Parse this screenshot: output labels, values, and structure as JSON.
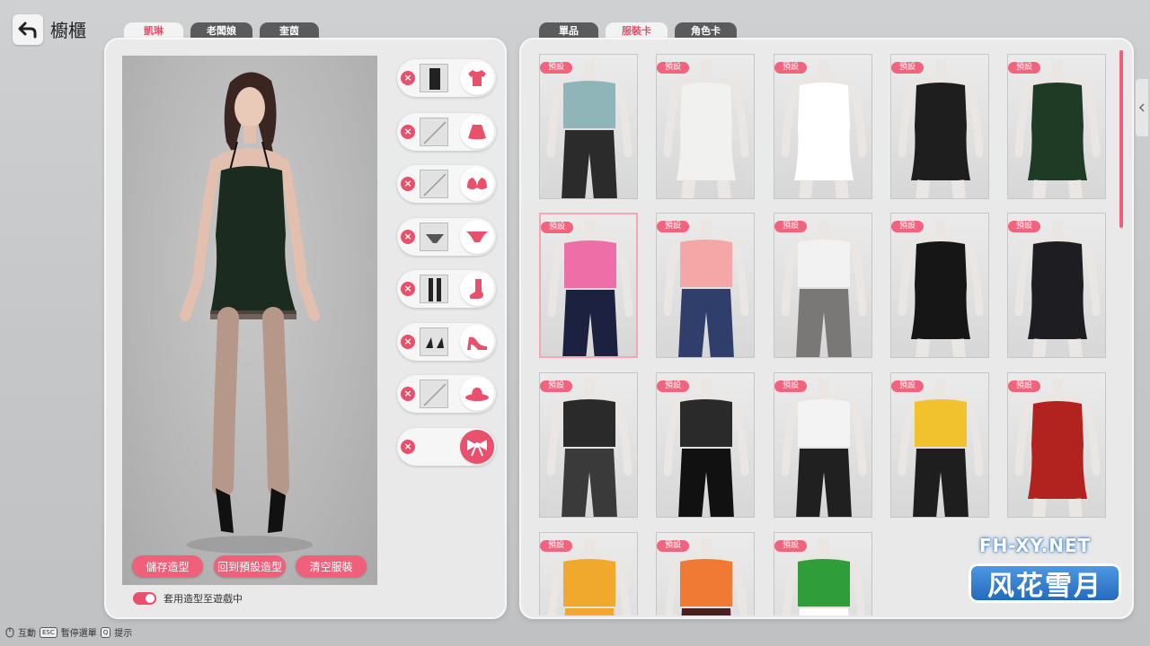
{
  "header": {
    "title": "櫥櫃"
  },
  "character_tabs": [
    {
      "label": "凱琳",
      "active": true
    },
    {
      "label": "老闆娘",
      "active": false
    },
    {
      "label": "奎茵",
      "active": false
    }
  ],
  "item_tabs": [
    {
      "label": "單品",
      "active": false
    },
    {
      "label": "服裝卡",
      "active": true
    },
    {
      "label": "角色卡",
      "active": false
    }
  ],
  "actions": {
    "save": "儲存造型",
    "reset": "回到預設造型",
    "clear": "清空服裝"
  },
  "apply_toggle": {
    "label": "套用造型至遊戲中",
    "on": true
  },
  "slots": [
    {
      "category": "top",
      "has_item": true,
      "icon": "shirt-icon"
    },
    {
      "category": "skirt",
      "has_item": false,
      "icon": "skirt-icon"
    },
    {
      "category": "bra",
      "has_item": false,
      "icon": "bra-icon"
    },
    {
      "category": "panties",
      "has_item": true,
      "icon": "panties-icon"
    },
    {
      "category": "socks",
      "has_item": true,
      "icon": "sock-icon"
    },
    {
      "category": "shoes",
      "has_item": true,
      "icon": "heel-icon"
    },
    {
      "category": "hat",
      "has_item": false,
      "icon": "hat-icon"
    },
    {
      "category": "accessory",
      "has_item": false,
      "icon": "bow-icon"
    }
  ],
  "outfit_badge": "預設",
  "outfits": [
    {
      "top": "#8fb5b8",
      "bottom": "#2b2b2b",
      "dress": false
    },
    {
      "top": "#f1f1ef",
      "bottom": "#f1f1ef",
      "dress": true
    },
    {
      "top": "#ffffff",
      "bottom": "#f08aa6",
      "dress": true
    },
    {
      "top": "#1e1e1e",
      "bottom": "#1e1e1e",
      "dress": true
    },
    {
      "top": "#1f3b25",
      "bottom": "#1f3b25",
      "dress": true
    },
    {
      "top": "#ee6fa8",
      "bottom": "#1c2140",
      "dress": false,
      "selected": true
    },
    {
      "top": "#f5a6a6",
      "bottom": "#2f3e6b",
      "dress": false
    },
    {
      "top": "#f2f2f2",
      "bottom": "#7a7777",
      "dress": false
    },
    {
      "top": "#161616",
      "bottom": "#161616",
      "dress": true
    },
    {
      "top": "#1d1d22",
      "bottom": "#26262b",
      "dress": true
    },
    {
      "top": "#2a2a2a",
      "bottom": "#3a3a3a",
      "dress": false
    },
    {
      "top": "#2a2a2a",
      "bottom": "#111111",
      "dress": false
    },
    {
      "top": "#f3f3f3",
      "bottom": "#202020",
      "dress": false
    },
    {
      "top": "#f2c12e",
      "bottom": "#1e1e1e",
      "dress": false
    },
    {
      "top": "#b2221f",
      "bottom": "#b2221f",
      "dress": true
    },
    {
      "top": "#f0a92c",
      "bottom": "#f0a92c",
      "dress": false
    },
    {
      "top": "#f07a33",
      "bottom": "#4a1f22",
      "dress": false
    },
    {
      "top": "#2f9e3a",
      "bottom": "#ffffff",
      "dress": false
    }
  ],
  "hints": [
    {
      "key": "",
      "label": "互動"
    },
    {
      "key": "ESC",
      "label": "暫停選單"
    },
    {
      "key": "Q",
      "label": "提示"
    }
  ],
  "watermark": {
    "text": "FH-XY.NET",
    "logo": "风花雪月"
  },
  "colors": {
    "accent": "#e8506c",
    "tab_dark": "#5b5b5b"
  }
}
